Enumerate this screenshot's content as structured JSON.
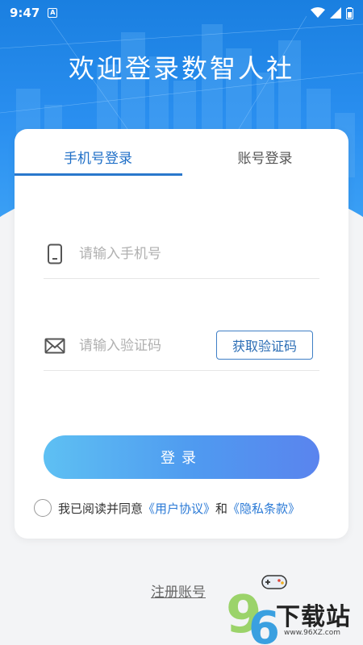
{
  "status_bar": {
    "time": "9:47",
    "app_badge": "A"
  },
  "header": {
    "title": "欢迎登录数智人社"
  },
  "tabs": [
    {
      "label": "手机号登录",
      "active": true
    },
    {
      "label": "账号登录",
      "active": false
    }
  ],
  "phone_field": {
    "placeholder": "请输入手机号",
    "icon": "phone-icon"
  },
  "code_field": {
    "placeholder": "请输入验证码",
    "icon": "mail-icon",
    "button_label": "获取验证码"
  },
  "login_button": {
    "label": "登录"
  },
  "agreement": {
    "prefix": "我已阅读并同意",
    "user_agreement": "《用户协议》",
    "conjunction": "和",
    "privacy_policy": "《隐私条款》"
  },
  "register_link": {
    "label": "注册账号"
  },
  "watermark": {
    "text": "下载站",
    "domain": "www.96XZ.com"
  },
  "colors": {
    "primary": "#2a78cc",
    "link": "#2b7ad6",
    "hero": "#1a7fe0"
  }
}
